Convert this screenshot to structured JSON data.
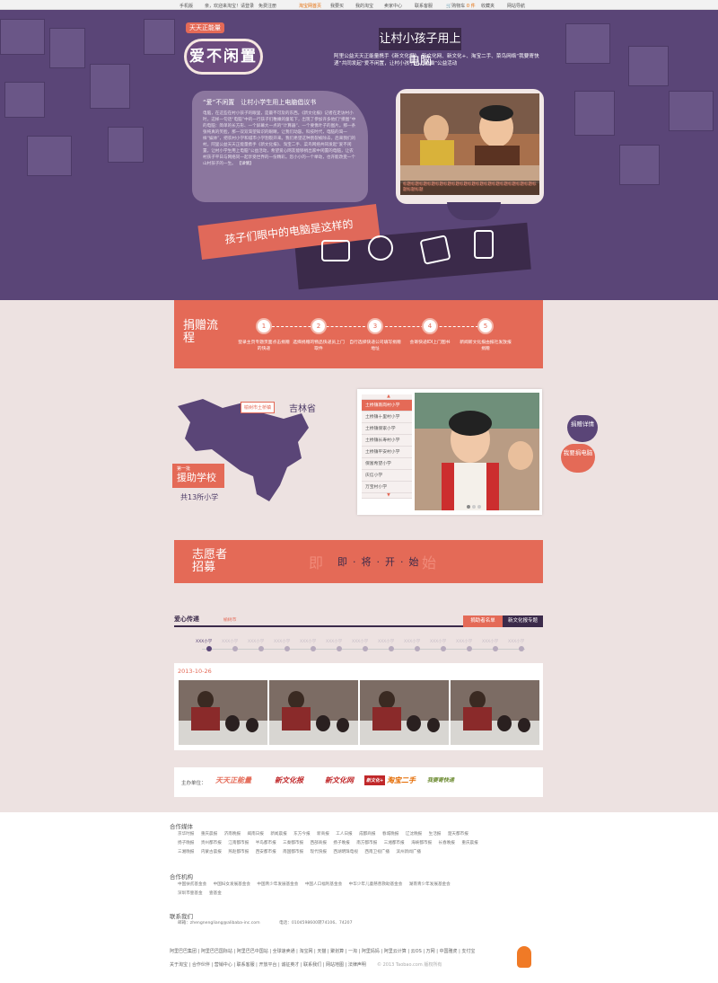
{
  "topbar": {
    "mobile": "手机版",
    "welcome": "亲，欢迎来淘宝！请登录",
    "register": "免费注册",
    "home": "淘宝网首页",
    "mytaobao": "我要买",
    "my": "我的淘宝",
    "seller": "卖家中心",
    "contact": "联系客服",
    "cart": "购物车",
    "cart_count": "0 件",
    "fav": "收藏夹",
    "sitenav": "网站导航"
  },
  "hero": {
    "mini_logo": "天天正能量",
    "logo": "爱不闲置",
    "title": "让村小孩子用上电脑",
    "subtitle": "阿里公益天天正能量携手《新文化报》、新文化网、新文化+、淘宝二手、菜鸟网络“我要寄快递”共同发起“爱不闲置，让村小孩子用上电脑”公益活动",
    "bubble_title": "“爱”不闲置　让村小学生用上电脑倡议书",
    "bubble_text": "电脑，在这些在村小孩子的眼里，是最不可及的东西。《新文化报》记者在走访村小时，这样一句话“电脑”中的一行孩子们稚嫩的童笔下，出现了参加许多他们“摸图”中的电脑：简单的长方形、一个屏幕大一点的“计算器”、一个要像叶子的图片。那一条张纯真的笑脸，那一双双渴望知识的眼睛，让我们动容。科技时代，电脑的渴一样“娱体”，把农村小学和城市小学割裂开来。我们希望这种割裂被除去，后来我们的村。阿里公益天天正能量携手《新文化报》、淘宝二手、菜鸟网络共同发起“爱不闲置，让村小学生用上电脑”公益活动，希望爱心网友能够捐出家中闲置的电脑，让农村孩子平日与网络同一起享受世界的一份精彩。您小小的一个举动，也许能改变一个山村孩子的一生。",
    "bubble_more": "【详情】",
    "monitor_caption": "标题标题标题标题标题标题标题标题标题标题标题标题标题标题标题标题标题标题标题",
    "ribbon": "孩子们眼中的电脑是这样的"
  },
  "donate": {
    "label": "捐赠流程",
    "steps": [
      {
        "num": "1",
        "text": "登录主页专题页面点击捐赠的快递"
      },
      {
        "num": "2",
        "text": "选择捐赠的物品快递员上门取件"
      },
      {
        "num": "3",
        "text": "自行选择快递公司填写捐赠地址"
      },
      {
        "num": "4",
        "text": "会寄快递IDI上门图书"
      },
      {
        "num": "5",
        "text": "新闻新文化报由报社发放报捐赠"
      }
    ]
  },
  "map": {
    "pin_label": "榆树市土桥镇",
    "province": "吉林省",
    "assist_small": "第一批",
    "assist_big": "援助学校",
    "total": "共13所小学"
  },
  "school": {
    "items": [
      "土桥镇南岗村小学",
      "土桥镇十里村小学",
      "土桥镇保家小学",
      "土桥镇长寿村小学",
      "土桥镇平安村小学",
      "保富希望小学",
      "庆信小学",
      "万宝村小学"
    ],
    "side_detail": "捐赠详情",
    "side_donate": "我要捐电脑"
  },
  "volunteer": {
    "label": "志愿者招募",
    "coming": "即·将·开·始",
    "ghost_left": "即",
    "ghost_right": "始"
  },
  "love": {
    "title": "爱心传递",
    "location": "榆树市",
    "tab_list": "捐助者名单",
    "tab_special": "新文化报专题",
    "timeline": [
      "XXX小学",
      "XXX小学",
      "XXX小学",
      "XXX小学",
      "XXX小学",
      "XXX小学",
      "XXX小学",
      "XXX小学",
      "XXX小学",
      "XXX小学",
      "XXX小学",
      "XXX小学",
      "XXX小学"
    ],
    "date": "2013-10-26"
  },
  "sponsor": {
    "label": "主办单位：",
    "logos": [
      "天天正能量",
      "新文化报",
      "新文化网",
      "新文化+",
      "淘宝二手",
      "我要寄快递"
    ]
  },
  "footer": {
    "media_title": "合作媒体",
    "media_rows": [
      "京华时报 重庆晨报 济南晚报 闽南日报 新闻晨报 东方今报 新商报 工人日报 成都商报 春城晚报 辽沈晚报 生活报 楚天都市报",
      "扬子晚报 贵州都市报 江南都市报 半岛都市报 三秦都市报 西部商报 扬子晚报 南方都市报 三湘都市报 海峡都市报 长春晚报 重庆晨报",
      "三湘晚报 内蒙古晨报 燕赵都市报 西安都市报 南国都市报 现代快报 西湖明珠电视 西南卫视广播 滨州新闻广播"
    ],
    "org_title": "合作机构",
    "org_rows": [
      "中国扶贫基金会 中国妇女发展基金会 中国青少年发展基金会 中国人口福利基金会 中华少年儿童慈善救助基金会 湖南青少年发展基金会",
      "深圳市壹基金 壹基金"
    ],
    "contact_title": "联系我们",
    "email": "邮箱：zhengnengliang@alibaba-inc.com",
    "phone": "电话：0104598600转74106、74207",
    "bottom1": "阿里巴巴集团 | 阿里巴巴国际站 | 阿里巴巴中国站 | 全球速卖通 | 淘宝网 | 天猫 | 聚划算 | 一淘 | 阿里妈妈 | 阿里云计算 | 云OS | 万网 | 中国雅虎 | 支付宝",
    "bottom2": "关于淘宝 | 合作伙伴 | 营销中心 | 联系客服 | 开放平台 | 诚征英才 | 联系我们 | 网站地图 | 法律声明",
    "copyright": "© 2013 Taobao.com 版权所有"
  },
  "colors": {
    "purple": "#5a4577",
    "coral": "#e46a57",
    "dark": "#3b2a4a"
  }
}
